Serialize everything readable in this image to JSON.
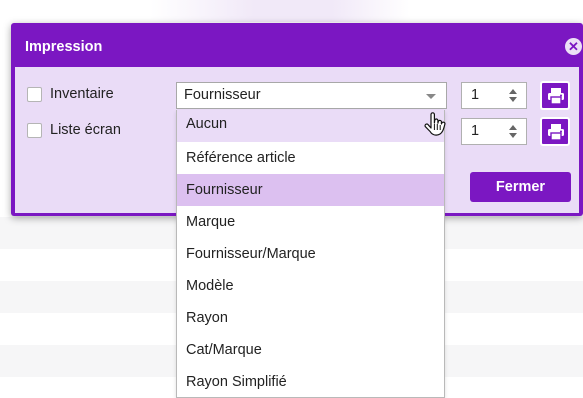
{
  "dialog": {
    "title": "Impression",
    "close_icon": "close-circle-icon",
    "rows": [
      {
        "label": "Inventaire",
        "checked": false,
        "quantity": "1"
      },
      {
        "label": "Liste écran",
        "checked": false,
        "quantity": "1"
      }
    ],
    "select": {
      "value": "Fournisseur"
    },
    "print_icon": "printer-icon",
    "close_button_label": "Fermer"
  },
  "dropdown": {
    "options": [
      "Aucun",
      "Référence article",
      "Fournisseur",
      "Marque",
      "Fournisseur/Marque",
      "Modèle",
      "Rayon",
      "Cat/Marque",
      "Rayon Simplifié"
    ],
    "hovered": "Aucun",
    "selected": "Fournisseur"
  },
  "colors": {
    "accent": "#7b17c2",
    "dialog_body": "#eadcf7",
    "selected_option": "#dcc0f0"
  }
}
